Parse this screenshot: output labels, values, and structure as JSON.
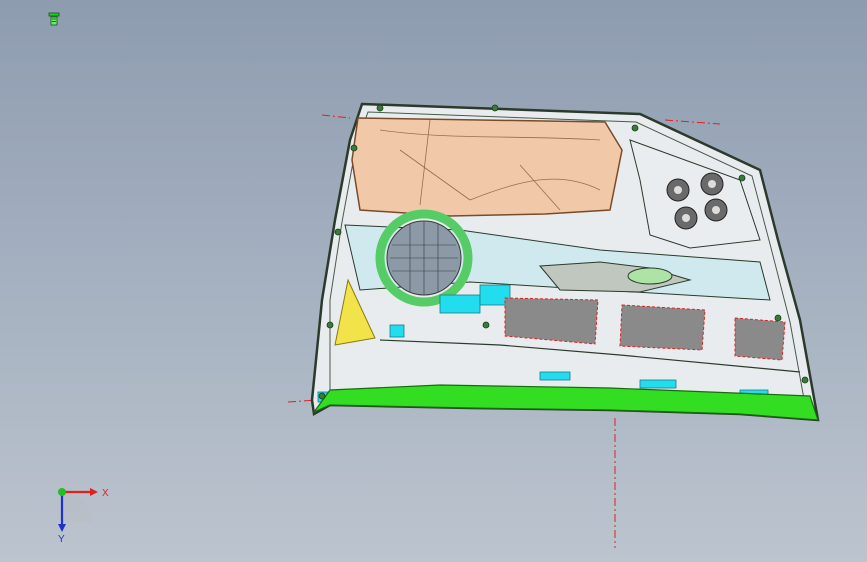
{
  "viewport": {
    "background_top": "#8e9cb0",
    "background_bottom": "#bcc4ce",
    "tree_icon": "feature-tree-icon"
  },
  "triad": {
    "x_label": "X",
    "y_label": "Y",
    "x_color": "#e02020",
    "y_color": "#2030d0",
    "z_color": "#20c020"
  },
  "model": {
    "name": "door-trim-panel",
    "colors": {
      "outline": "#2b3a2b",
      "bottom_strip": "#33dd22",
      "armrest": "#f1c9a8",
      "speaker_ring": "#55cc66",
      "map_pocket": "#8a8a8a",
      "clips": "#22ddee",
      "yellow_part": "#f3e34a",
      "centerline": "#dd2222"
    }
  }
}
